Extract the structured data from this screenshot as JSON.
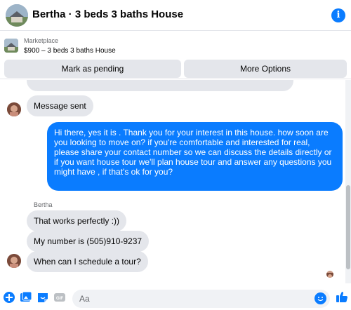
{
  "header": {
    "title": "Bertha · 3 beds 3 baths House",
    "info_icon": "info-icon"
  },
  "listing": {
    "kicker": "Marketplace",
    "subtitle": "$900 – 3 beds 3 baths House",
    "buttons": {
      "pending": "Mark as pending",
      "more": "More Options"
    }
  },
  "messages": {
    "msg_sent": "Message sent",
    "outgoing": "Hi there, yes it is . Thank you for your interest in this house. how soon are you looking to move on? if you're comfortable and interested for real, please share your contact number so we can discuss the details directly or if you  want house tour we'll plan house tour and answer any questions you might have , if that's ok for you?",
    "sender_name": "Bertha",
    "reply1": "That works perfectly :))",
    "reply2": "My number is (505)910-9237",
    "reply3": "When can I schedule a tour?"
  },
  "composer": {
    "placeholder": "Aa",
    "icons": [
      "plus-icon",
      "image-icon",
      "sticker-icon",
      "gif-icon",
      "emoji-icon",
      "like-icon"
    ]
  },
  "colors": {
    "accent": "#0a7cff",
    "bubble_in": "#e4e6eb",
    "muted": "#65676b"
  }
}
